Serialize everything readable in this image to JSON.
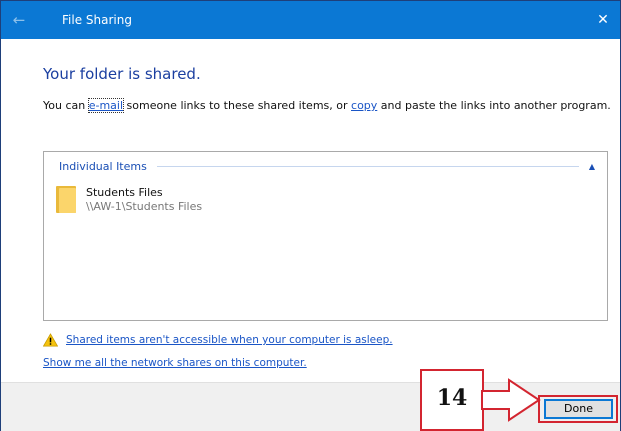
{
  "titlebar": {
    "title": "File Sharing",
    "back_icon": "arrow-left-icon",
    "close_icon": "close-icon",
    "color": "#0b78d4"
  },
  "heading": "Your folder is shared.",
  "description": {
    "prefix": "You can ",
    "email_link": "e-mail",
    "middle": " someone links to these shared items, or ",
    "copy_link": "copy",
    "suffix": " and paste the links into another program."
  },
  "items_group": {
    "title": "Individual Items",
    "chevron_icon": "chevron-up-icon",
    "items": [
      {
        "name": "Students Files",
        "path": "\\\\AW-1\\Students Files",
        "icon": "folder-icon"
      }
    ]
  },
  "warning": {
    "icon": "warning-icon",
    "link": "Shared items aren't accessible when your computer is asleep."
  },
  "shares_link": "Show me all the network shares on this computer.",
  "footer": {
    "done_label": "Done"
  },
  "annotation": {
    "step_number": "14",
    "color": "#d32530"
  }
}
